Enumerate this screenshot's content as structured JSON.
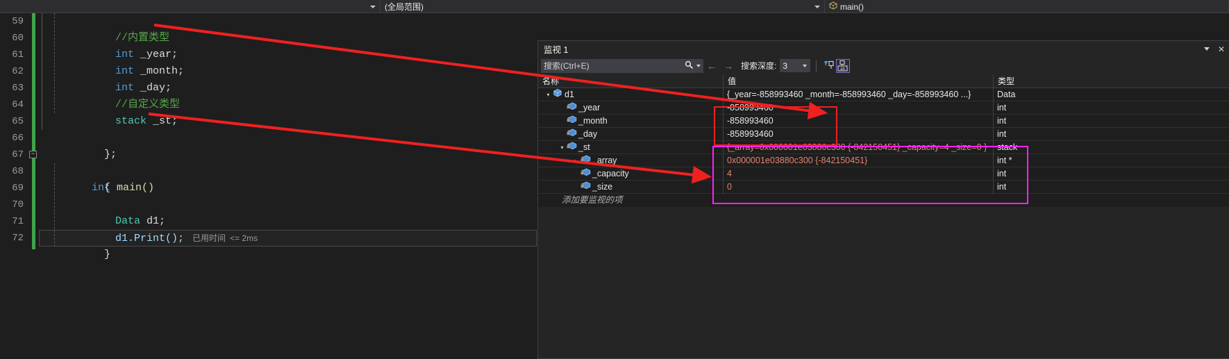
{
  "navbar": {
    "scope_dropdown": "",
    "member_dropdown": "(全局范围)",
    "function_dropdown": "main()",
    "function_icon": "cube-icon"
  },
  "editor": {
    "line_numbers": [
      "59",
      "60",
      "61",
      "62",
      "63",
      "64",
      "65",
      "66",
      "67",
      "68",
      "69",
      "70",
      "71",
      "72"
    ],
    "lines": [
      {
        "n": "59",
        "kind": "comment",
        "text": "//内置类型"
      },
      {
        "n": "60",
        "kind": "decl",
        "type": "int",
        "name": " _year;"
      },
      {
        "n": "61",
        "kind": "decl",
        "type": "int",
        "name": " _month;"
      },
      {
        "n": "62",
        "kind": "decl",
        "type": "int",
        "name": " _day;"
      },
      {
        "n": "63",
        "kind": "comment",
        "text": "//自定义类型"
      },
      {
        "n": "64",
        "kind": "decl",
        "type": "stack",
        "name": " _st;"
      },
      {
        "n": "65",
        "kind": "blank",
        "text": ""
      },
      {
        "n": "66",
        "kind": "plain",
        "text": "};"
      },
      {
        "n": "67",
        "kind": "func",
        "type": "int",
        "name": " main()"
      },
      {
        "n": "68",
        "kind": "plain",
        "text": "{"
      },
      {
        "n": "69",
        "kind": "blank",
        "text": ""
      },
      {
        "n": "70",
        "kind": "decl",
        "type": "Data",
        "name": " d1;"
      },
      {
        "n": "71",
        "kind": "call",
        "text": "d1.Print();"
      },
      {
        "n": "72",
        "kind": "plain",
        "text": "}"
      }
    ],
    "elapsed_label": "已用时间",
    "elapsed_value": "<= 2ms"
  },
  "watch": {
    "title": "监视 1",
    "search_placeholder": "搜索(Ctrl+E)",
    "search_icon": "magnifier-icon",
    "back_icon": "arrow-left-icon",
    "forward_icon": "arrow-right-icon",
    "depth_label": "搜索深度:",
    "depth_value": "3",
    "pin_button_icon": "filter-pin-icon",
    "hex_button_icon": "hex-display-icon",
    "minimize_icon": "chevron-down-icon",
    "close_icon": "close-icon",
    "columns": [
      "名称",
      "值",
      "类型"
    ],
    "add_item_text": "添加要监视的项",
    "rows": [
      {
        "name": "d1",
        "value": "{_year=-858993460 _month=-858993460 _day=-858993460 ...}",
        "type": "Data",
        "indent": 0,
        "expander": "expanded",
        "icon": "struct-icon",
        "changed": false
      },
      {
        "name": "_year",
        "value": "-858993460",
        "type": "int",
        "indent": 1,
        "expander": "none",
        "icon": "field-private-icon",
        "changed": false
      },
      {
        "name": "_month",
        "value": "-858993460",
        "type": "int",
        "indent": 1,
        "expander": "none",
        "icon": "field-private-icon",
        "changed": false
      },
      {
        "name": "_day",
        "value": "-858993460",
        "type": "int",
        "indent": 1,
        "expander": "none",
        "icon": "field-private-icon",
        "changed": false
      },
      {
        "name": "_st",
        "value": "{_array=0x000001e03880c300 {-842150451} _capacity=4 _size=0 }",
        "type": "stack",
        "indent": 1,
        "expander": "expanded",
        "icon": "field-private-icon",
        "changed": true
      },
      {
        "name": "_array",
        "value": "0x000001e03880c300 {-842150451}",
        "type": "int *",
        "indent": 2,
        "expander": "collapsed",
        "icon": "field-private-icon",
        "changed": true
      },
      {
        "name": "_capacity",
        "value": "4",
        "type": "int",
        "indent": 2,
        "expander": "none",
        "icon": "field-private-icon",
        "changed": true
      },
      {
        "name": "_size",
        "value": "0",
        "type": "int",
        "indent": 2,
        "expander": "none",
        "icon": "field-private-icon",
        "changed": true
      }
    ]
  },
  "annotations": {
    "red_box_label": "red-highlight-box",
    "magenta_box_label": "magenta-highlight-box",
    "arrow_color": "#f02020",
    "magenta_color": "#ff20ff"
  }
}
